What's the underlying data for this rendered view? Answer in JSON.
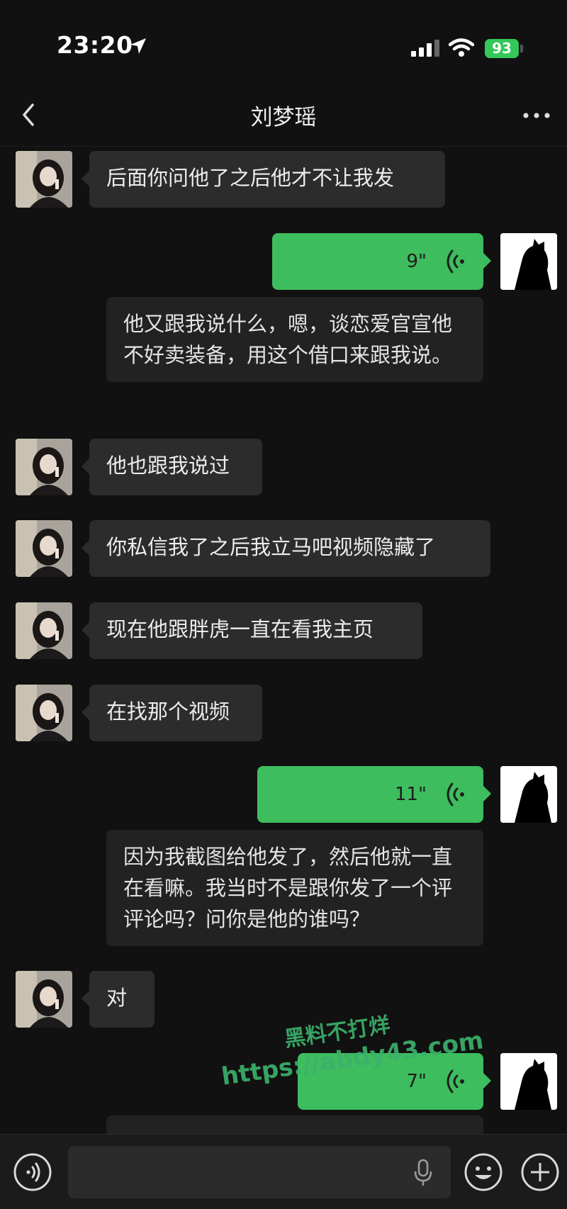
{
  "status_bar": {
    "time": "23:20",
    "battery": "93"
  },
  "header": {
    "title": "刘梦瑶"
  },
  "messages": [
    {
      "text": "后面你问他了之后他才不让我发"
    },
    {
      "duration": "9\"",
      "transcript": "他又跟我说什么，嗯，谈恋爱官宣他不好卖装备，用这个借口来跟我说。"
    },
    {
      "text": "他也跟我说过"
    },
    {
      "text": "你私信我了之后我立马吧视频隐藏了"
    },
    {
      "text": "现在他跟胖虎一直在看我主页"
    },
    {
      "text": "在找那个视频"
    },
    {
      "duration": "11\"",
      "transcript": "因为我截图给他发了，然后他就一直在看嘛。我当时不是跟你发了一个评评论吗？问你是他的谁吗？"
    },
    {
      "text": "对"
    },
    {
      "duration": "7\""
    }
  ],
  "watermark": {
    "line1": "黑料不打烊",
    "line2": "https://abdy43.com"
  },
  "icons": [
    "location-arrow-icon",
    "signal-icon",
    "wifi-icon",
    "back-chevron-icon",
    "more-icon",
    "voice-input-icon",
    "microphone-icon",
    "emoji-icon",
    "plus-icon",
    "voice-wave-icon"
  ],
  "colors": {
    "background": "#111111",
    "bubble_received": "#2c2c2c",
    "bubble_sent": "#3ebd5e",
    "accent": "#3bb06b"
  }
}
